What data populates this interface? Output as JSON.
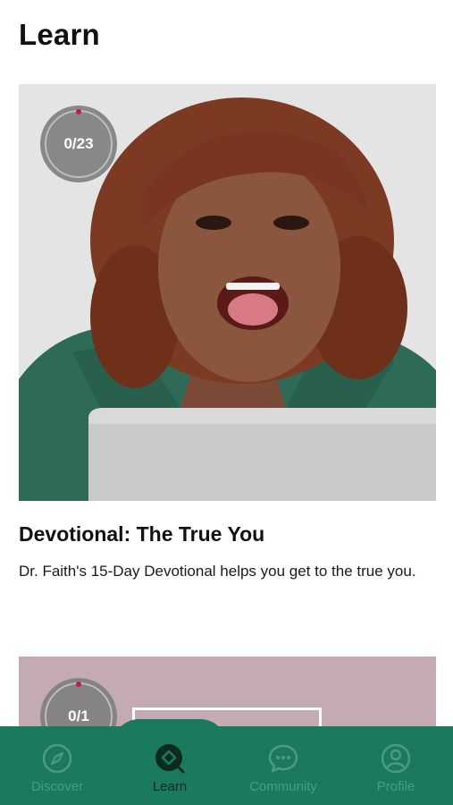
{
  "header": {
    "title": "Learn"
  },
  "courses": [
    {
      "progress": "0/23",
      "title": "Devotional: The True You",
      "description": "Dr. Faith's 15-Day Devotional helps you get to the true you."
    },
    {
      "progress": "0/1"
    }
  ],
  "nav": {
    "items": [
      {
        "label": "Discover",
        "icon": "compass-icon"
      },
      {
        "label": "Learn",
        "icon": "learn-icon"
      },
      {
        "label": "Community",
        "icon": "chat-bubble-icon"
      },
      {
        "label": "Profile",
        "icon": "user-icon"
      }
    ],
    "active": "Learn"
  },
  "colors": {
    "nav_background": "#1b7a5e",
    "nav_inactive": "#4a9b80",
    "nav_active": "#0d2a20",
    "progress_dot": "#c2185b"
  }
}
